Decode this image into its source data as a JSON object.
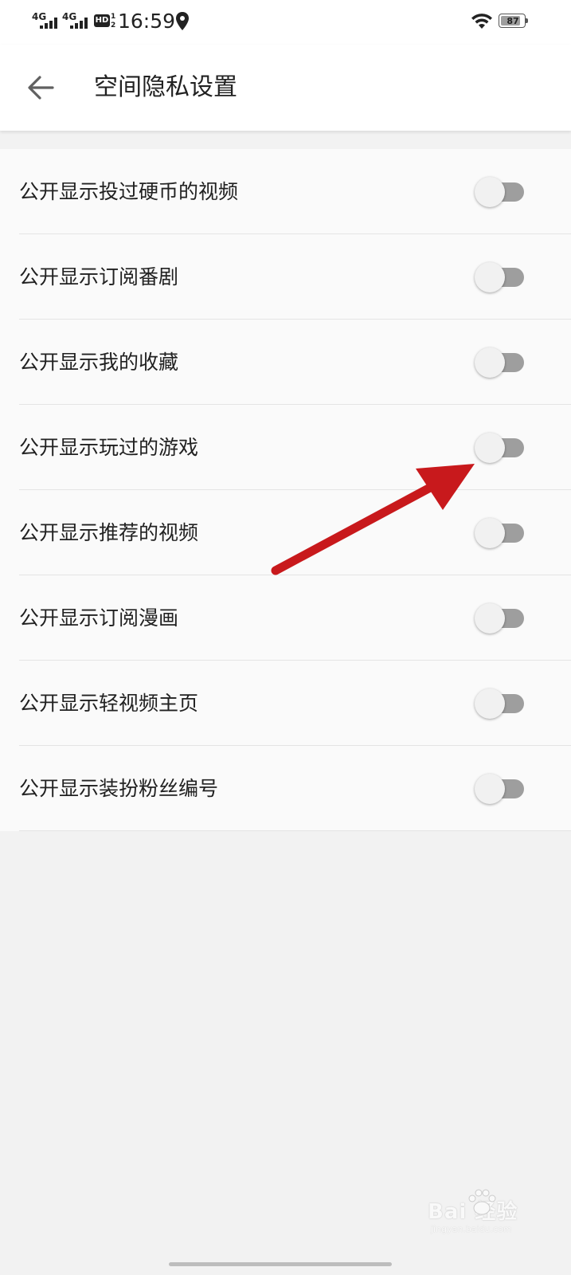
{
  "status_bar": {
    "sim1_label": "4G",
    "sim2_label": "4G",
    "hd_label": "HD",
    "hd_sub": "1 2",
    "time": "16:59",
    "battery_level": "87",
    "battery_fraction": 0.87,
    "icons": [
      "signal-icon",
      "signal-icon",
      "hd-voice-icon",
      "location-icon",
      "wifi-icon",
      "battery-icon"
    ]
  },
  "header": {
    "title": "空间隐私设置",
    "back_icon": "arrow-left-icon"
  },
  "settings": {
    "items": [
      {
        "label": "公开显示投过硬币的视频",
        "enabled": false
      },
      {
        "label": "公开显示订阅番剧",
        "enabled": false
      },
      {
        "label": "公开显示我的收藏",
        "enabled": false
      },
      {
        "label": "公开显示玩过的游戏",
        "enabled": false
      },
      {
        "label": "公开显示推荐的视频",
        "enabled": false
      },
      {
        "label": "公开显示订阅漫画",
        "enabled": false
      },
      {
        "label": "公开显示轻视频主页",
        "enabled": false
      },
      {
        "label": "公开显示装扮粉丝编号",
        "enabled": false
      }
    ]
  },
  "annotation": {
    "arrow_color": "#c8191c",
    "points_to": "公开显示玩过的游戏"
  },
  "watermark": {
    "logo": "Bai  经验",
    "sub": "jingyan.baidu.com"
  },
  "colors": {
    "toggle_track_off": "#9e9e9e",
    "toggle_thumb_off": "#f1f1f1",
    "list_background": "#fafafa",
    "page_background": "#f2f2f2"
  }
}
